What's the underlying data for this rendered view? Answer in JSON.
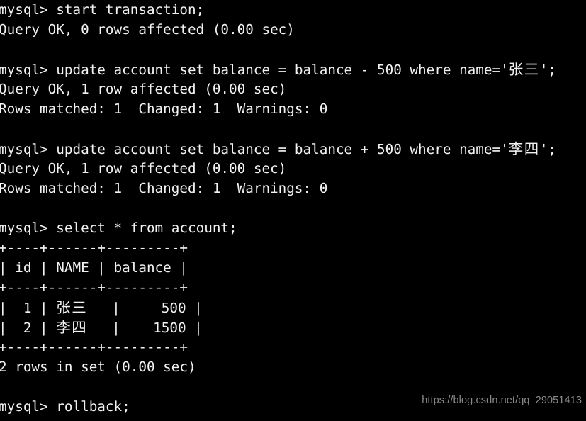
{
  "terminal": {
    "prompt": "mysql> ",
    "background_color": "#000000",
    "text_color": "#f2f2f2",
    "lines": [
      {
        "id": "cmd-start-transaction",
        "text": "mysql> start transaction;"
      },
      {
        "id": "result-start-transaction",
        "text": "Query OK, 0 rows affected (0.00 sec)"
      },
      {
        "id": "blank-1",
        "text": ""
      },
      {
        "id": "cmd-update-zhangsan",
        "text": "mysql> update account set balance = balance - 500 where name='张三';"
      },
      {
        "id": "result-update-zhangsan",
        "text": "Query OK, 1 row affected (0.00 sec)"
      },
      {
        "id": "rows-matched-zhangsan",
        "text": "Rows matched: 1  Changed: 1  Warnings: 0"
      },
      {
        "id": "blank-2",
        "text": ""
      },
      {
        "id": "cmd-update-lisi",
        "text": "mysql> update account set balance = balance + 500 where name='李四';"
      },
      {
        "id": "result-update-lisi",
        "text": "Query OK, 1 row affected (0.00 sec)"
      },
      {
        "id": "rows-matched-lisi",
        "text": "Rows matched: 1  Changed: 1  Warnings: 0"
      },
      {
        "id": "blank-3",
        "text": ""
      },
      {
        "id": "cmd-select-account",
        "text": "mysql> select * from account;"
      },
      {
        "id": "table-border-top",
        "text": "+----+------+---------+"
      },
      {
        "id": "table-header",
        "text": "| id | NAME | balance |"
      },
      {
        "id": "table-border-mid",
        "text": "+----+------+---------+"
      },
      {
        "id": "table-row-1",
        "text": "|  1 | 张三   |     500 |"
      },
      {
        "id": "table-row-2",
        "text": "|  2 | 李四   |    1500 |"
      },
      {
        "id": "table-border-bottom",
        "text": "+----+------+---------+"
      },
      {
        "id": "result-select-account",
        "text": "2 rows in set (0.00 sec)"
      },
      {
        "id": "blank-4",
        "text": ""
      },
      {
        "id": "cmd-rollback",
        "text": "mysql> rollback;"
      }
    ]
  },
  "query_result": {
    "table_name": "account",
    "columns": [
      "id",
      "NAME",
      "balance"
    ],
    "rows": [
      {
        "id": "1",
        "NAME": "张三",
        "balance": "500"
      },
      {
        "id": "2",
        "NAME": "李四",
        "balance": "1500"
      }
    ],
    "row_count_label": "2 rows in set (0.00 sec)"
  },
  "watermark": {
    "text": "https://blog.csdn.net/qq_29051413",
    "color": "#8a8a8a"
  }
}
